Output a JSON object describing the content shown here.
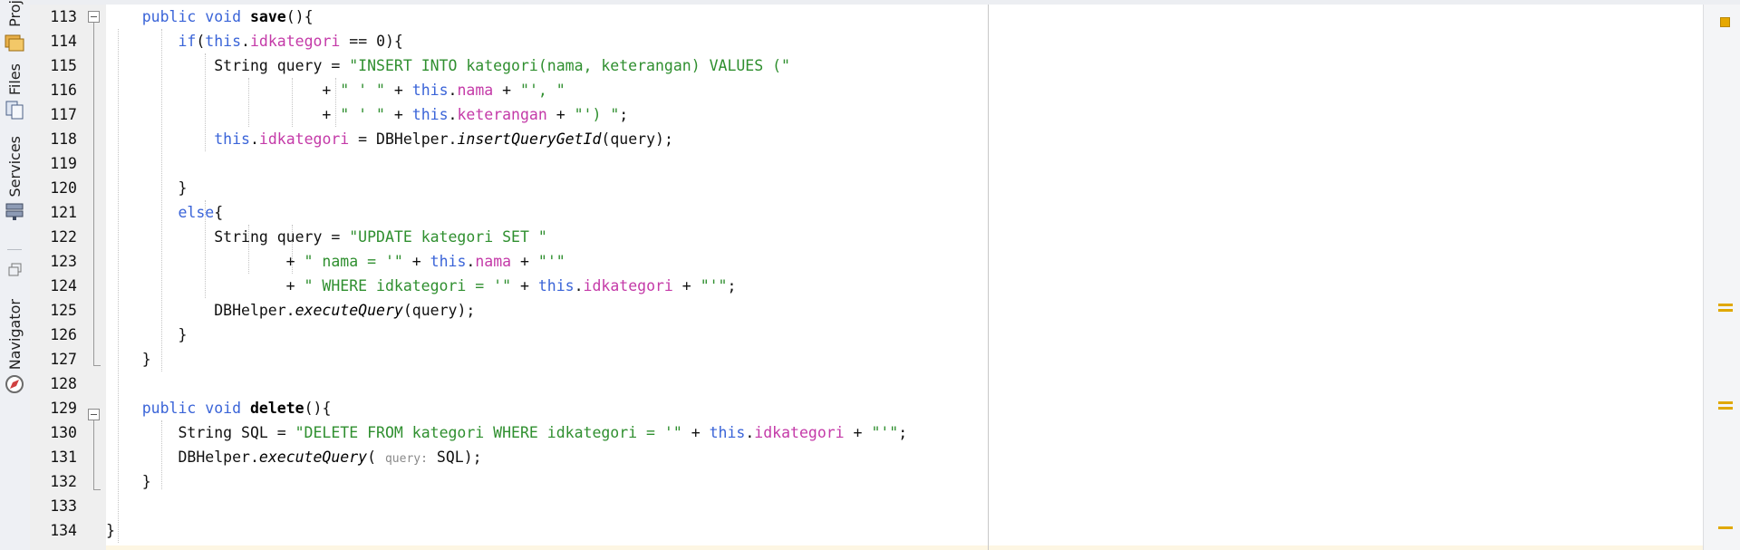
{
  "sidebar": {
    "tabs": [
      {
        "label": "Proj"
      },
      {
        "label": "Files"
      },
      {
        "label": "Services"
      },
      {
        "label": "Navigator"
      }
    ]
  },
  "editor": {
    "line_numbers": [
      "113",
      "114",
      "115",
      "116",
      "117",
      "118",
      "119",
      "120",
      "121",
      "122",
      "123",
      "124",
      "125",
      "126",
      "127",
      "128",
      "129",
      "130",
      "131",
      "132",
      "133",
      "134"
    ],
    "lines": [
      [
        {
          "t": "    "
        },
        {
          "t": "public void ",
          "c": "kw"
        },
        {
          "t": "save",
          "c": "mth"
        },
        {
          "t": "(){"
        }
      ],
      [
        {
          "t": "        "
        },
        {
          "t": "if",
          "c": "kw"
        },
        {
          "t": "("
        },
        {
          "t": "this",
          "c": "kw"
        },
        {
          "t": "."
        },
        {
          "t": "idkategori",
          "c": "fld"
        },
        {
          "t": " == 0){"
        }
      ],
      [
        {
          "t": "            String query = "
        },
        {
          "t": "\"INSERT INTO kategori(nama, keterangan) VALUES (\"",
          "c": "str"
        }
      ],
      [
        {
          "t": "                        + "
        },
        {
          "t": "\" ' \"",
          "c": "str"
        },
        {
          "t": " + "
        },
        {
          "t": "this",
          "c": "kw"
        },
        {
          "t": "."
        },
        {
          "t": "nama",
          "c": "fld"
        },
        {
          "t": " + "
        },
        {
          "t": "\"', \"",
          "c": "str"
        }
      ],
      [
        {
          "t": "                        + "
        },
        {
          "t": "\" ' \"",
          "c": "str"
        },
        {
          "t": " + "
        },
        {
          "t": "this",
          "c": "kw"
        },
        {
          "t": "."
        },
        {
          "t": "keterangan",
          "c": "fld"
        },
        {
          "t": " + "
        },
        {
          "t": "\"') \"",
          "c": "str"
        },
        {
          "t": ";"
        }
      ],
      [
        {
          "t": "            "
        },
        {
          "t": "this",
          "c": "kw"
        },
        {
          "t": "."
        },
        {
          "t": "idkategori",
          "c": "fld"
        },
        {
          "t": " = DBHelper."
        },
        {
          "t": "insertQueryGetId",
          "c": "sta"
        },
        {
          "t": "(query);"
        }
      ],
      [
        {
          "t": ""
        }
      ],
      [
        {
          "t": "        }"
        }
      ],
      [
        {
          "t": "        "
        },
        {
          "t": "else",
          "c": "kw"
        },
        {
          "t": "{"
        }
      ],
      [
        {
          "t": "            String query = "
        },
        {
          "t": "\"UPDATE kategori SET \"",
          "c": "str"
        }
      ],
      [
        {
          "t": "                    + "
        },
        {
          "t": "\" nama = '\"",
          "c": "str"
        },
        {
          "t": " + "
        },
        {
          "t": "this",
          "c": "kw"
        },
        {
          "t": "."
        },
        {
          "t": "nama",
          "c": "fld"
        },
        {
          "t": " + "
        },
        {
          "t": "\"'\"",
          "c": "str"
        }
      ],
      [
        {
          "t": "                    + "
        },
        {
          "t": "\" WHERE idkategori = '\"",
          "c": "str"
        },
        {
          "t": " + "
        },
        {
          "t": "this",
          "c": "kw"
        },
        {
          "t": "."
        },
        {
          "t": "idkategori",
          "c": "fld"
        },
        {
          "t": " + "
        },
        {
          "t": "\"'\"",
          "c": "str"
        },
        {
          "t": ";"
        }
      ],
      [
        {
          "t": "            DBHelper."
        },
        {
          "t": "executeQuery",
          "c": "sta"
        },
        {
          "t": "(query);"
        }
      ],
      [
        {
          "t": "        }"
        }
      ],
      [
        {
          "t": "    }"
        }
      ],
      [
        {
          "t": ""
        }
      ],
      [
        {
          "t": "    "
        },
        {
          "t": "public void ",
          "c": "kw"
        },
        {
          "t": "delete",
          "c": "mth"
        },
        {
          "t": "(){"
        }
      ],
      [
        {
          "t": "        String SQL = "
        },
        {
          "t": "\"DELETE FROM kategori WHERE idkategori = '\"",
          "c": "str"
        },
        {
          "t": " + "
        },
        {
          "t": "this",
          "c": "kw"
        },
        {
          "t": "."
        },
        {
          "t": "idkategori",
          "c": "fld"
        },
        {
          "t": " + "
        },
        {
          "t": "\"'\"",
          "c": "str"
        },
        {
          "t": ";"
        }
      ],
      [
        {
          "t": "        DBHelper."
        },
        {
          "t": "executeQuery",
          "c": "sta"
        },
        {
          "t": "( "
        },
        {
          "t": "query:",
          "c": "hint"
        },
        {
          "t": " SQL);"
        }
      ],
      [
        {
          "t": "    }"
        }
      ],
      [
        {
          "t": ""
        }
      ],
      [
        {
          "t": "}"
        }
      ]
    ]
  },
  "colors": {
    "keyword": "#3a64d8",
    "field": "#c43aa8",
    "string": "#2f8f2f",
    "gutter": "#efefef",
    "warning_mark": "#e0a800"
  }
}
